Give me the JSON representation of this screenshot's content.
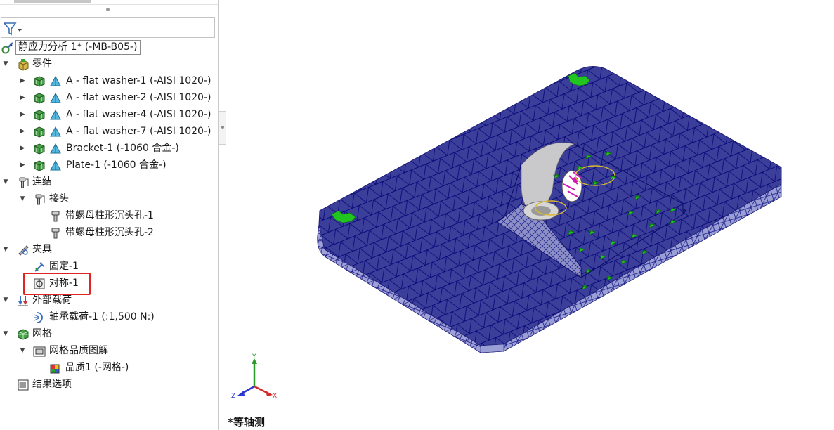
{
  "tree": {
    "root": {
      "label": "静应力分析 1* (-MB-B05-)"
    },
    "parts": {
      "label": "零件",
      "items": [
        {
          "label": "A - flat washer-1 (-AISI 1020-)"
        },
        {
          "label": "A - flat washer-2 (-AISI 1020-)"
        },
        {
          "label": "A - flat washer-4 (-AISI 1020-)"
        },
        {
          "label": "A - flat washer-7 (-AISI 1020-)"
        },
        {
          "label": "Bracket-1 (-1060 合金-)"
        },
        {
          "label": "Plate-1 (-1060 合金-)"
        }
      ]
    },
    "connections": {
      "label": "连结",
      "joint": {
        "label": "接头",
        "items": [
          {
            "label": "带螺母柱形沉头孔-1"
          },
          {
            "label": "带螺母柱形沉头孔-2"
          }
        ]
      }
    },
    "fixtures": {
      "label": "夹具",
      "items": [
        {
          "label": "固定-1"
        },
        {
          "label": "对称-1"
        }
      ]
    },
    "loads": {
      "label": "外部载荷",
      "items": [
        {
          "label": "轴承载荷-1 (:1,500 N:)"
        }
      ]
    },
    "mesh": {
      "label": "网格",
      "quality_plot": {
        "label": "网格品质图解",
        "items": [
          {
            "label": "品质1 (-网格-)"
          }
        ]
      }
    },
    "result_options": {
      "label": "结果选项"
    }
  },
  "viewport": {
    "view_label": "*等轴测",
    "triad": {
      "x": "X",
      "y": "Y",
      "z": "Z"
    },
    "colors": {
      "mesh_face": "#3c3f9a",
      "mesh_line": "#0a0a7a",
      "mesh_side": "#9fa1d8",
      "fixture": "#22c41f",
      "load": "#d219b8"
    }
  }
}
